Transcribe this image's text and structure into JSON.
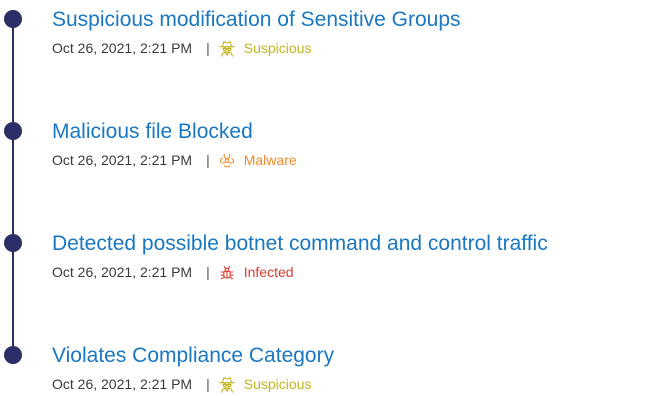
{
  "colors": {
    "title": "#1a78c2",
    "timeline": "#2a2d66",
    "suspicious": "#c4b41e",
    "malware": "#ef8a2a",
    "infected": "#de3b2e"
  },
  "events": [
    {
      "title": "Suspicious modification of Sensitive Groups",
      "timestamp": "Oct 26, 2021, 2:21 PM",
      "separator": "|",
      "category": "Suspicious",
      "icon": "spy-icon"
    },
    {
      "title": "Malicious file Blocked",
      "timestamp": "Oct 26, 2021, 2:21 PM",
      "separator": "|",
      "category": "Malware",
      "icon": "biohazard-icon"
    },
    {
      "title": "Detected possible botnet command and control traffic",
      "timestamp": "Oct 26, 2021, 2:21 PM",
      "separator": "|",
      "category": "Infected",
      "icon": "bug-icon"
    },
    {
      "title": "Violates Compliance Category",
      "timestamp": "Oct 26, 2021, 2:21 PM",
      "separator": "|",
      "category": "Suspicious",
      "icon": "spy-icon"
    }
  ]
}
